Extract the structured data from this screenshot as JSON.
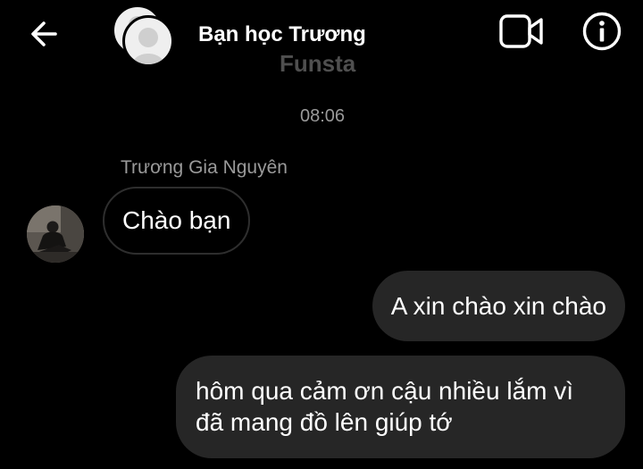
{
  "header": {
    "title": "Bạn học Trương",
    "subtitle": "Funsta",
    "back_icon": "arrow-left-icon",
    "video_icon": "video-camera-icon",
    "info_icon": "info-circle-icon"
  },
  "conversation": {
    "timestamp": "08:06",
    "messages": [
      {
        "direction": "incoming",
        "sender": "Trương Gia Nguyên",
        "text": "Chào bạn"
      },
      {
        "direction": "outgoing",
        "text": "A xin chào xin chào"
      },
      {
        "direction": "outgoing",
        "text": "hôm qua cảm ơn cậu nhiều lắm vì đã mang đồ lên giúp tớ"
      }
    ]
  },
  "colors": {
    "background": "#000000",
    "outgoing_bubble": "#262626",
    "incoming_bubble_border": "#2e2e2e",
    "muted_text": "#9a9a9a",
    "subtitle_text": "#4f4f4f"
  }
}
